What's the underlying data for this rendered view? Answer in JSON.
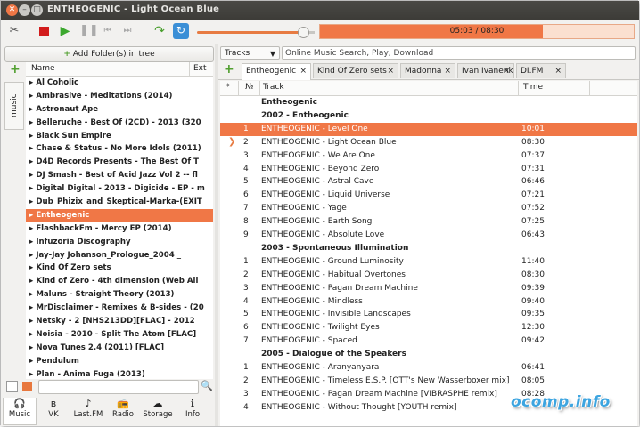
{
  "window": {
    "title": "ENTHEOGENIC - Light Ocean Blue"
  },
  "toolbar": {
    "icons": [
      "tools-icon",
      "stop-icon",
      "play-icon",
      "pause-icon",
      "prev-icon",
      "next-icon",
      "jump-icon",
      "repeat-icon"
    ],
    "volume_fraction": 0.95,
    "progress_fraction": 0.71,
    "time_text": "05:03 / 08:30"
  },
  "left": {
    "add_folder_label": "Add Folder(s) in tree",
    "vertical_tab": "music",
    "col_name": "Name",
    "col_ext": "Ext",
    "folders": [
      "Al Coholic",
      "Ambrasive - Meditations (2014)",
      "Astronaut Ape",
      "Belleruche - Best Of (2CD) - 2013 (320",
      "Black Sun Empire",
      "Chase & Status - No More Idols (2011)",
      "D4D Records Presents - The Best Of T",
      "DJ Smash - Best of Acid Jazz Vol 2 -- fl",
      "Digital Digital - 2013 - Digicide - EP - m",
      "Dub_Phizix_and_Skeptical-Marka-(EXIT",
      "Entheogenic",
      "FlashbackFm - Mercy EP (2014)",
      "Infuzoria Discography",
      "Jay-Jay Johanson_Prologue_2004 _",
      "Kind Of Zero sets",
      "Kind of Zero  - 4th dimension (Web All",
      "Maluns - Straight Theory (2013)",
      "MrDisclaimer - Remixes & B-sides - (20",
      "Netsky - 2 [NHS213DD][FLAC] - 2012",
      "Noisia - 2010 - Split The Atom [FLAC]",
      "Nova Tunes 2.4 (2011) [FLAC]",
      "Pendulum",
      "Plan - Anima Fuga (2013)"
    ],
    "selected_folder": "Entheogenic",
    "bottom_tabs": [
      "Music",
      "VK",
      "Last.FM",
      "Radio",
      "Storage",
      "Info"
    ]
  },
  "right": {
    "tracks_combo": "Tracks",
    "online_search_placeholder": "Online Music Search, Play, Download",
    "tabs": [
      {
        "label": "Entheogenic",
        "close": "×"
      },
      {
        "label": "Kind Of Zero sets",
        "close": "×"
      },
      {
        "label": "Madonna",
        "close": "×"
      },
      {
        "label": "Ivan Ivanenko",
        "close": "×"
      },
      {
        "label": "DI.FM",
        "close": "×"
      }
    ],
    "columns": {
      "star": "*",
      "num": "№",
      "track": "Track",
      "time": "Time"
    },
    "rows": [
      {
        "type": "group",
        "track": "Entheogenic"
      },
      {
        "type": "group",
        "track": "2002 - Entheogenic"
      },
      {
        "type": "track",
        "num": "1",
        "track": "ENTHEOGENIC - Level One",
        "time": "10:01",
        "selected": true
      },
      {
        "type": "track",
        "num": "2",
        "track": "ENTHEOGENIC - Light Ocean Blue",
        "time": "08:30",
        "playing": true
      },
      {
        "type": "track",
        "num": "3",
        "track": "ENTHEOGENIC - We Are One",
        "time": "07:37"
      },
      {
        "type": "track",
        "num": "4",
        "track": "ENTHEOGENIC - Beyond Zero",
        "time": "07:31"
      },
      {
        "type": "track",
        "num": "5",
        "track": "ENTHEOGENIC - Astral Cave",
        "time": "06:46"
      },
      {
        "type": "track",
        "num": "6",
        "track": "ENTHEOGENIC - Liquid Universe",
        "time": "07:21"
      },
      {
        "type": "track",
        "num": "7",
        "track": "ENTHEOGENIC - Yage",
        "time": "07:52"
      },
      {
        "type": "track",
        "num": "8",
        "track": "ENTHEOGENIC - Earth Song",
        "time": "07:25"
      },
      {
        "type": "track",
        "num": "9",
        "track": "ENTHEOGENIC - Absolute Love",
        "time": "06:43"
      },
      {
        "type": "group",
        "track": "2003 - Spontaneous Illumination"
      },
      {
        "type": "track",
        "num": "1",
        "track": "ENTHEOGENIC - Ground Luminosity",
        "time": "11:40"
      },
      {
        "type": "track",
        "num": "2",
        "track": "ENTHEOGENIC - Habitual Overtones",
        "time": "08:30"
      },
      {
        "type": "track",
        "num": "3",
        "track": "ENTHEOGENIC - Pagan Dream Machine",
        "time": "09:39"
      },
      {
        "type": "track",
        "num": "4",
        "track": "ENTHEOGENIC - Mindless",
        "time": "09:40"
      },
      {
        "type": "track",
        "num": "5",
        "track": "ENTHEOGENIC - Invisible Landscapes",
        "time": "09:35"
      },
      {
        "type": "track",
        "num": "6",
        "track": "ENTHEOGENIC - Twilight Eyes",
        "time": "12:30"
      },
      {
        "type": "track",
        "num": "7",
        "track": "ENTHEOGENIC - Spaced",
        "time": "09:42"
      },
      {
        "type": "group",
        "track": "2005 - Dialogue of the Speakers"
      },
      {
        "type": "track",
        "num": "1",
        "track": "ENTHEOGENIC - Aranyanyara",
        "time": "06:41"
      },
      {
        "type": "track",
        "num": "2",
        "track": "ENTHEOGENIC - Timeless E.S.P. [OTT's New Wasserboxer mix]",
        "time": "08:05"
      },
      {
        "type": "track",
        "num": "3",
        "track": "ENTHEOGENIC - Pagan Dream Machine [VIBRASPHE remix]",
        "time": "08:28"
      },
      {
        "type": "track",
        "num": "4",
        "track": "ENTHEOGENIC - Without Thought [YOUTH remix]",
        "time": ""
      }
    ]
  },
  "watermark": "ocomp.info",
  "colors": {
    "accent": "#f07746",
    "titlebar": "#3c3b37"
  }
}
